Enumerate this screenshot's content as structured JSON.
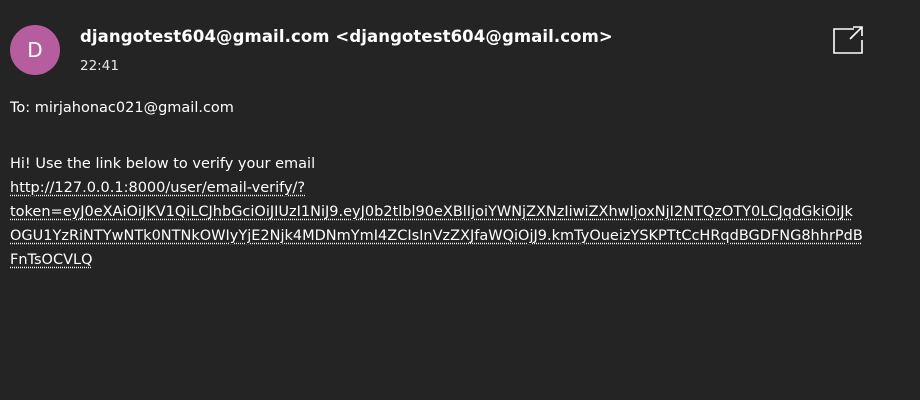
{
  "header": {
    "avatar_letter": "D",
    "avatar_color": "#b55d9e",
    "sender": "djangotest604@gmail.com <djangotest604@gmail.com>",
    "time": "22:41",
    "popout_icon": "open-in-new-window-icon"
  },
  "recipient": {
    "line": "To: mirjahonac021@gmail.com"
  },
  "message": {
    "intro": "Hi! Use the link below to verify your email",
    "link_lines": [
      "http://127.0.0.1:8000/user/email-verify/?",
      "token=eyJ0eXAiOiJKV1QiLCJhbGciOiJIUzI1NiJ9.eyJ0b2tlbl90eXBlIjoiYWNjZXNzIiwiZXhwIjoxNjI2NTQzOTY0LCJqdGkiOiJk",
      "OGU1YzRiNTYwNTk0NTNkOWIyYjE2Njk4MDNmYmI4ZCIsInVzZXJfaWQiOjJ9.kmTyOueizYSKPTtCcHRqdBGDFNG8hhrPdB",
      "FnTsOCVLQ"
    ]
  },
  "colors": {
    "background": "#242424",
    "text": "#ffffff"
  }
}
